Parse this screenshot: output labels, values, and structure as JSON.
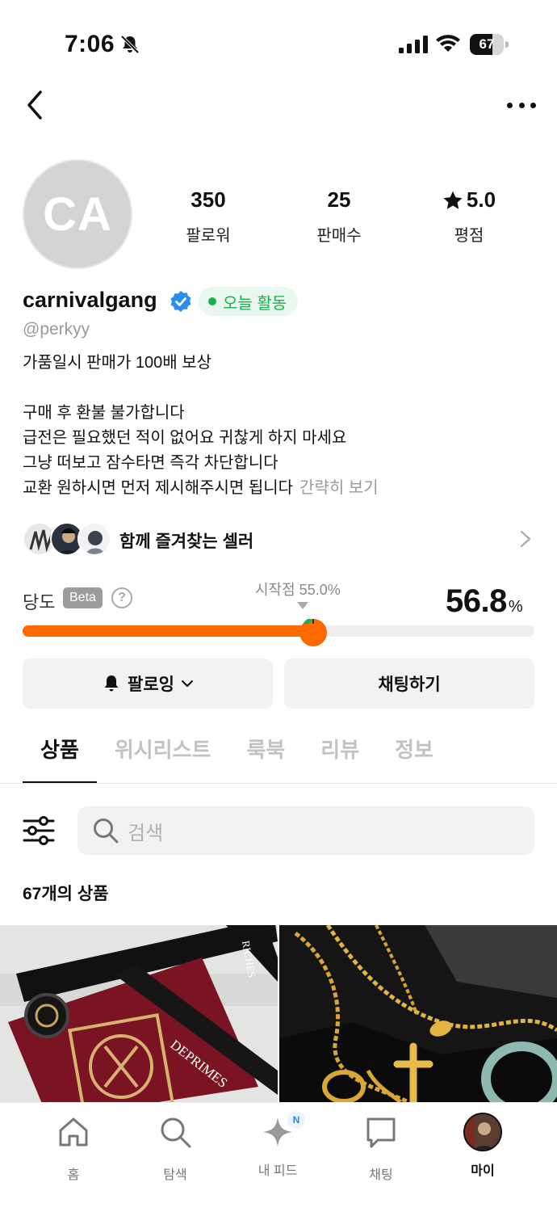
{
  "status_bar": {
    "time": "7:06",
    "battery": "67",
    "battery_level": 0.67
  },
  "profile": {
    "avatar_initials": "CA",
    "stats": [
      {
        "value": "350",
        "label": "팔로워"
      },
      {
        "value": "25",
        "label": "판매수"
      },
      {
        "value": "5.0",
        "label": "평점"
      }
    ],
    "username": "carnivalgang",
    "active_badge": "오늘 활동",
    "handle": "@perkyy",
    "bio": [
      "가품일시 판매가 100배 보상",
      "",
      "구매 후 환불 불가합니다",
      "급전은 필요했던 적이 없어요 귀찮게 하지 마세요",
      "그냥 떠보고 잠수타면 즉각 차단합니다",
      "교환 원하시면 먼저 제시해주시면 됩니다"
    ],
    "bio_more": "간략히 보기"
  },
  "favorite_sellers": {
    "label": "함께 즐겨찾는 셀러"
  },
  "temperature": {
    "label": "당도",
    "beta": "Beta",
    "help": "?",
    "start_label": "시작점 55.0%",
    "start_value": 55.0,
    "value": "56.8",
    "unit": "%",
    "level": 56.8
  },
  "buttons": {
    "follow": "팔로잉",
    "chat": "채팅하기"
  },
  "tabs": [
    {
      "label": "상품",
      "active": true
    },
    {
      "label": "위시리스트",
      "active": false
    },
    {
      "label": "룩북",
      "active": false
    },
    {
      "label": "리뷰",
      "active": false
    },
    {
      "label": "정보",
      "active": false
    }
  ],
  "search": {
    "placeholder": "검색"
  },
  "product_count": "67개의 상품",
  "products": [
    {
      "image_text": "DEPRIMES",
      "image_text2": "RICHES"
    },
    {
      "image_text": ""
    }
  ],
  "bottom_nav": [
    {
      "label": "홈",
      "icon": "home-icon"
    },
    {
      "label": "탐색",
      "icon": "search-icon"
    },
    {
      "label": "내 피드",
      "icon": "sparkle-icon",
      "badge": "N"
    },
    {
      "label": "채팅",
      "icon": "chat-icon"
    },
    {
      "label": "마이",
      "icon": "my-avatar",
      "active": true
    }
  ],
  "colors": {
    "accent": "#ff6a00",
    "active_green": "#16b14d",
    "verified_blue": "#2d8cf0"
  }
}
